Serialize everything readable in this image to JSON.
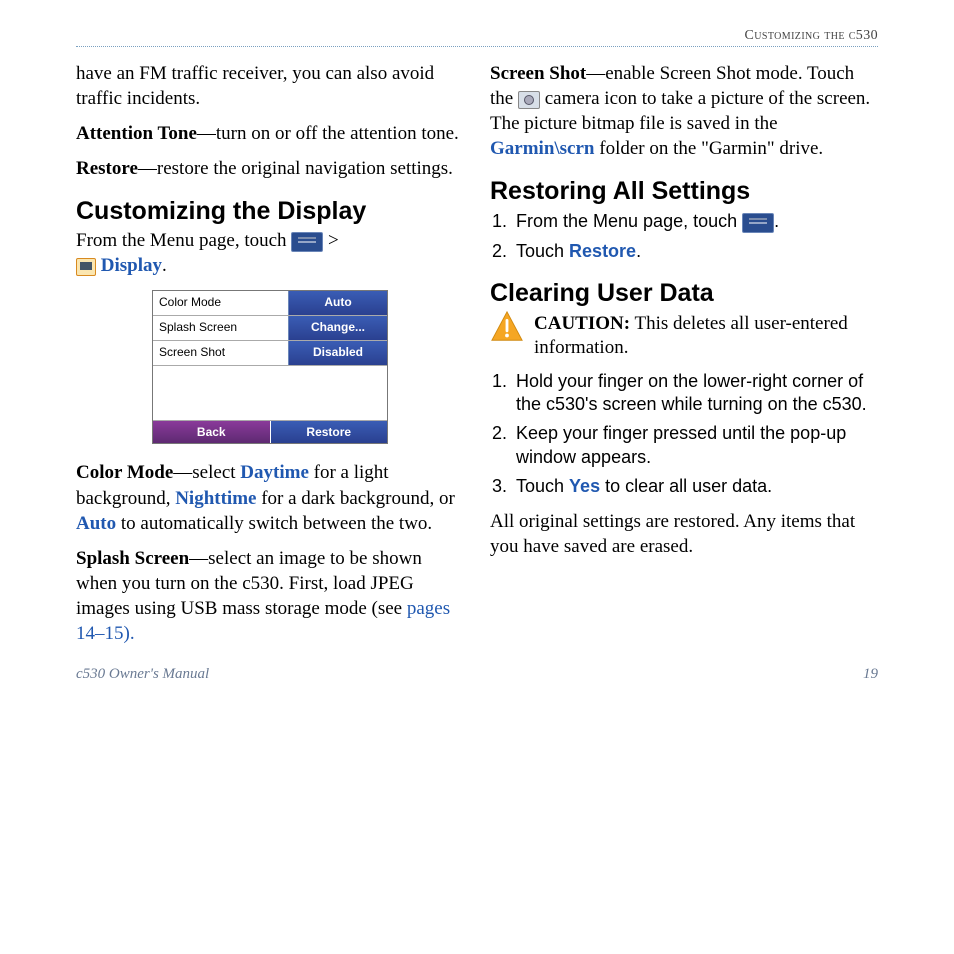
{
  "header": {
    "section_title": "Customizing the c530"
  },
  "left": {
    "intro": "have an FM traffic receiver, you can also avoid traffic incidents.",
    "attention_label": "Attention Tone",
    "attention_text": "—turn on or off the attention tone.",
    "restore_label": "Restore",
    "restore_text": "—restore the original navigation settings.",
    "h_custom": "Customizing the Display",
    "custom_intro_a": "From the Menu page, touch ",
    "custom_intro_b": " > ",
    "custom_display_link": "Display",
    "custom_intro_c": ".",
    "screenshot": {
      "rows": [
        {
          "label": "Color Mode",
          "value": "Auto"
        },
        {
          "label": "Splash Screen",
          "value": "Change..."
        },
        {
          "label": "Screen Shot",
          "value": "Disabled"
        }
      ],
      "back": "Back",
      "restore": "Restore"
    },
    "color_label": "Color Mode",
    "color_a": "—select ",
    "color_day": "Daytime",
    "color_b": " for a light background, ",
    "color_night": "Nighttime",
    "color_c": " for a dark background, or ",
    "color_auto": "Auto",
    "color_d": " to automatically switch between the two.",
    "splash_label": "Splash Screen",
    "splash_a": "—select an image to be shown when you turn on the c530. First, load JPEG images using USB mass storage mode (see ",
    "splash_link": "pages 14–15).",
    "splash_b": ""
  },
  "right": {
    "ss_label": "Screen Shot",
    "ss_a": "—enable Screen Shot mode. Touch the ",
    "ss_b": " camera icon to take a picture of the screen. The picture bitmap file is saved in the ",
    "ss_path": "Garmin\\scrn",
    "ss_c": " folder on the \"Garmin\" drive.",
    "h_restore": "Restoring All Settings",
    "restore_steps": {
      "s1a": "From the Menu page, touch ",
      "s1b": ".",
      "s2a": "Touch ",
      "s2_link": "Restore",
      "s2b": "."
    },
    "h_clear": "Clearing User Data",
    "caution_label": "CAUTION:",
    "caution_text": " This deletes all user-entered information.",
    "clear_steps": {
      "s1": "Hold your finger on the lower-right corner of the c530's screen while turning on the c530.",
      "s2": "Keep your finger pressed until the pop-up window appears.",
      "s3a": "Touch ",
      "s3_link": "Yes",
      "s3b": " to clear all user data."
    },
    "clear_after": "All original settings are restored. Any items that you have saved are erased."
  },
  "footer": {
    "left": "c530 Owner's Manual",
    "right": "19"
  }
}
